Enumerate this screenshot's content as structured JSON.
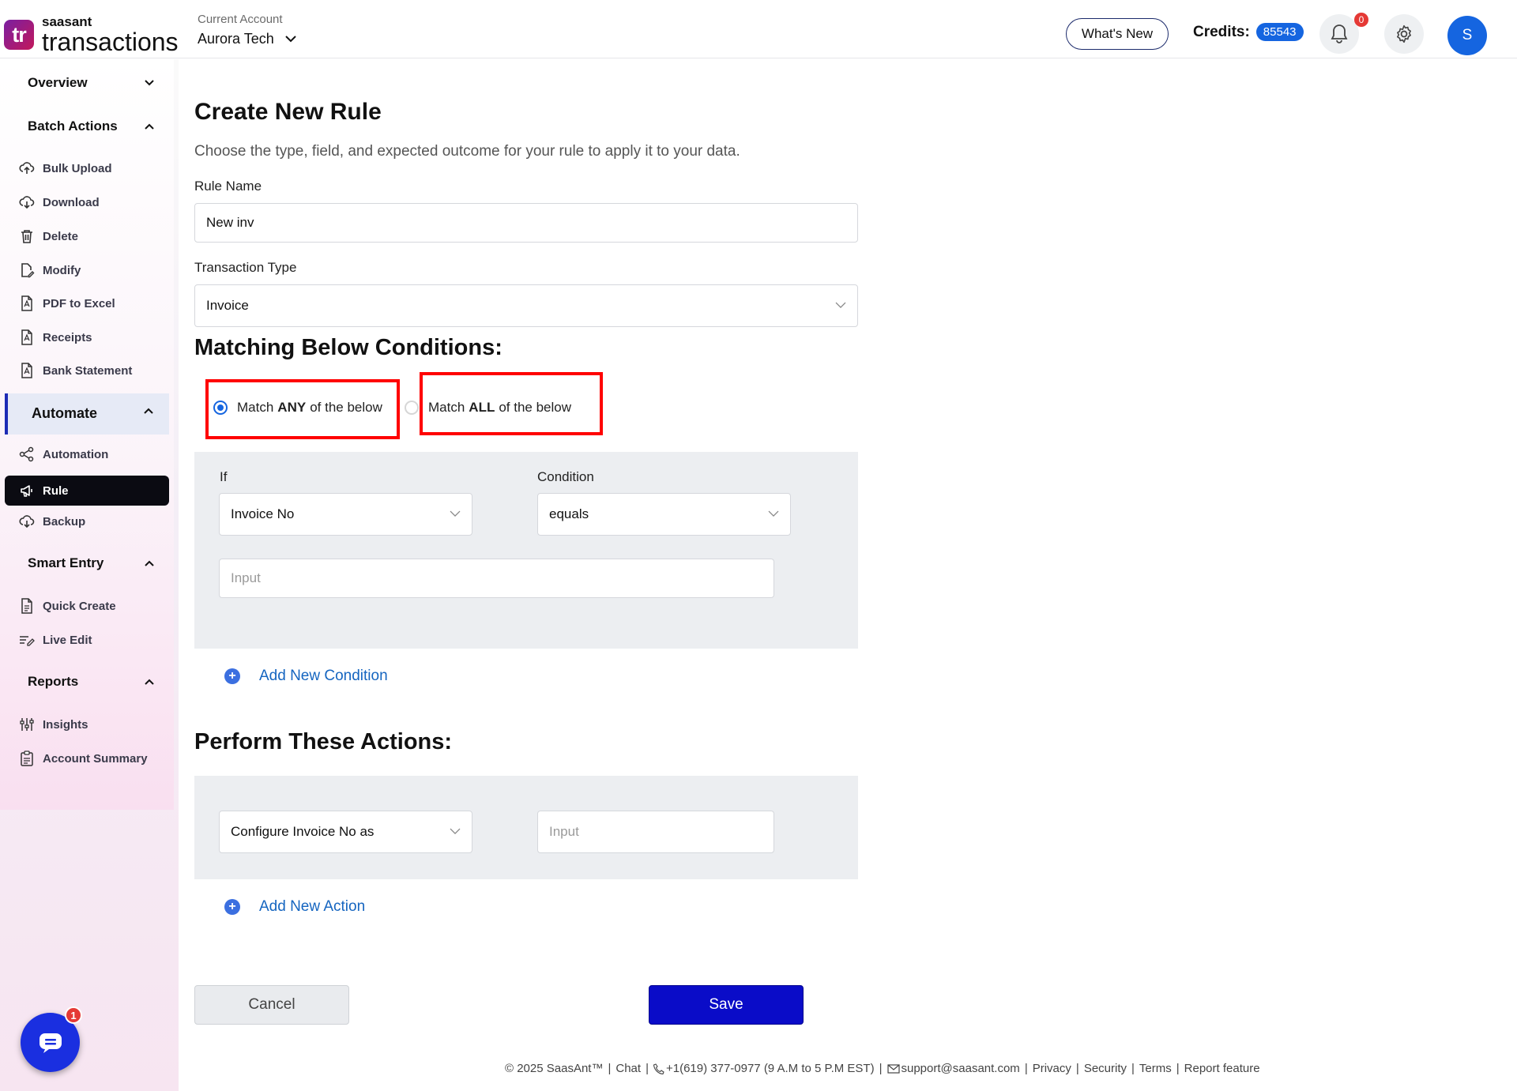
{
  "header": {
    "logo_small": "saasant",
    "logo_big": "transactions",
    "logo_badge": "tr",
    "account_label": "Current Account",
    "account_value": "Aurora Tech",
    "whats_new": "What's New",
    "credits_label": "Credits:",
    "credits_value": "85543",
    "notification_count": "0",
    "avatar_initial": "S"
  },
  "sidebar": {
    "overview": "Overview",
    "batch_actions": "Batch Actions",
    "batch_items": [
      "Bulk Upload",
      "Download",
      "Delete",
      "Modify",
      "PDF to Excel",
      "Receipts",
      "Bank Statement"
    ],
    "automate": "Automate",
    "automate_items": [
      "Automation",
      "Rule",
      "Backup"
    ],
    "smart_entry": "Smart Entry",
    "smart_items": [
      "Quick Create",
      "Live Edit"
    ],
    "reports": "Reports",
    "report_items": [
      "Insights",
      "Account Summary"
    ],
    "active_item": "Rule"
  },
  "main": {
    "title": "Create New Rule",
    "subtitle": "Choose the type, field, and expected outcome for your rule to apply it to your data.",
    "rule_name_label": "Rule Name",
    "rule_name_value": "New inv",
    "transaction_type_label": "Transaction Type",
    "transaction_type_value": "Invoice",
    "conditions_title": "Matching Below Conditions:",
    "match_any": {
      "pre": "Match",
      "bold": "ANY",
      "post": "of the below",
      "selected": true
    },
    "match_all": {
      "pre": "Match",
      "bold": "ALL",
      "post": "of the below",
      "selected": false
    },
    "condition": {
      "if_label": "If",
      "if_value": "Invoice No",
      "condition_label": "Condition",
      "condition_value": "equals",
      "input_placeholder": "Input"
    },
    "add_condition": "Add New Condition",
    "actions_title": "Perform These Actions:",
    "action": {
      "configure_value": "Configure Invoice No as",
      "input_placeholder": "Input"
    },
    "add_action": "Add New Action",
    "cancel": "Cancel",
    "save": "Save"
  },
  "footer": {
    "copyright": "© 2025 SaasAnt™",
    "chat": "Chat",
    "phone": "+1(619) 377-0977 (9 A.M to 5 P.M EST)",
    "email": "support@saasant.com",
    "privacy": "Privacy",
    "security": "Security",
    "terms": "Terms",
    "report_feature": "Report feature"
  },
  "chat_widget": {
    "badge": "1"
  },
  "colors": {
    "accent": "#1565e0",
    "save": "#0a0cc8",
    "highlight_box": "#ff0000",
    "active_nav": "#0b0b12"
  }
}
